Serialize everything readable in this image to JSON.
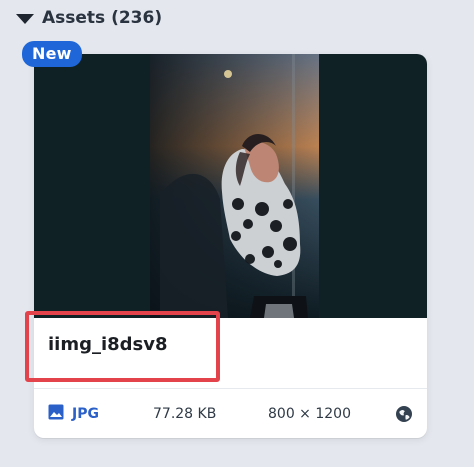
{
  "section": {
    "title": "Assets (236)",
    "collapsed": false
  },
  "asset": {
    "badge": "New",
    "name": "iimg_i8dsv8",
    "type": "JPG",
    "size": "77.28 KB",
    "dimensions": "800 × 1200",
    "icons": {
      "type_icon": "image-icon",
      "visibility_icon": "globe-icon",
      "collapse_icon": "triangle-down-icon"
    },
    "colors": {
      "badge": "#1f67d8",
      "highlight": "#e3434a",
      "link": "#2a60c8"
    }
  }
}
